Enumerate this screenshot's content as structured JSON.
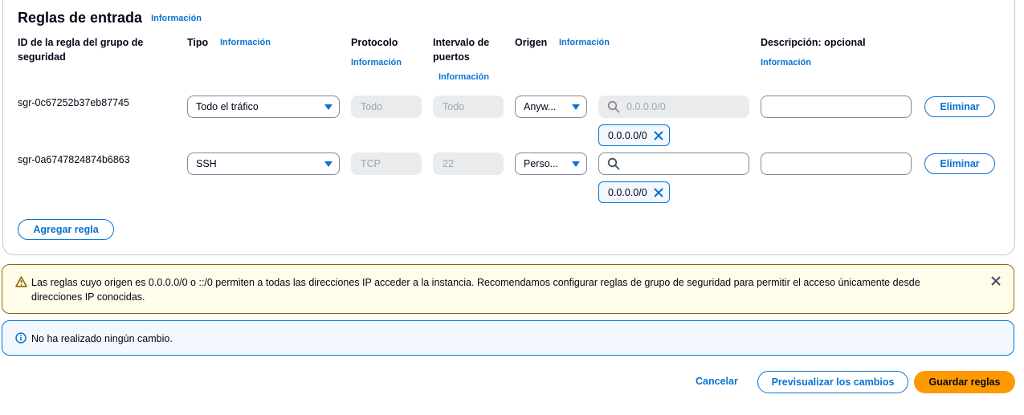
{
  "header": {
    "title": "Reglas de entrada",
    "info_link": "Información"
  },
  "columns": {
    "rule_id": "ID de la regla del grupo de seguridad",
    "rule_id_line1": "ID de la regla del grupo de",
    "rule_id_line2": "seguridad",
    "type": "Tipo",
    "type_info": "Información",
    "protocol": "Protocolo",
    "protocol_info": "Información",
    "port_range_line1": "Intervalo de",
    "port_range_line2": "puertos",
    "port_range_info": "Información",
    "source": "Origen",
    "source_info": "Información",
    "description": "Descripción: opcional",
    "description_info": "Información"
  },
  "rules": [
    {
      "id": "sgr-0c67252b37eb87745",
      "type": "Todo el tráfico",
      "protocol": "Todo",
      "port_range": "Todo",
      "source": "Anyw...",
      "search_placeholder": "0.0.0.0/0",
      "token": "0.0.0.0/0",
      "description": "",
      "delete_label": "Eliminar"
    },
    {
      "id": "sgr-0a6747824874b6863",
      "type": "SSH",
      "protocol": "TCP",
      "port_range": "22",
      "source": "Perso...",
      "search_placeholder": "",
      "token": "0.0.0.0/0",
      "description": "",
      "delete_label": "Eliminar"
    }
  ],
  "add_rule_label": "Agregar regla",
  "warning": {
    "line1": "Las reglas cuyo origen es 0.0.0.0/0 o ::/0 permiten a todas las direcciones IP acceder a la instancia. Recomendamos configurar reglas de grupo de seguridad para permitir el acceso únicamente desde",
    "line2": "direcciones IP conocidas.",
    "icon": "warning-triangle-icon"
  },
  "info_alert": {
    "text": "No ha realizado ningún cambio.",
    "icon": "info-circle-icon"
  },
  "footer": {
    "cancel": "Cancelar",
    "preview": "Previsualizar los cambios",
    "save": "Guardar reglas"
  },
  "colors": {
    "accent": "#0972d3",
    "primary_button": "#ff9900",
    "warning_border": "#8d6605",
    "warning_bg": "#fffce9",
    "info_bg": "#f2f8fd"
  }
}
